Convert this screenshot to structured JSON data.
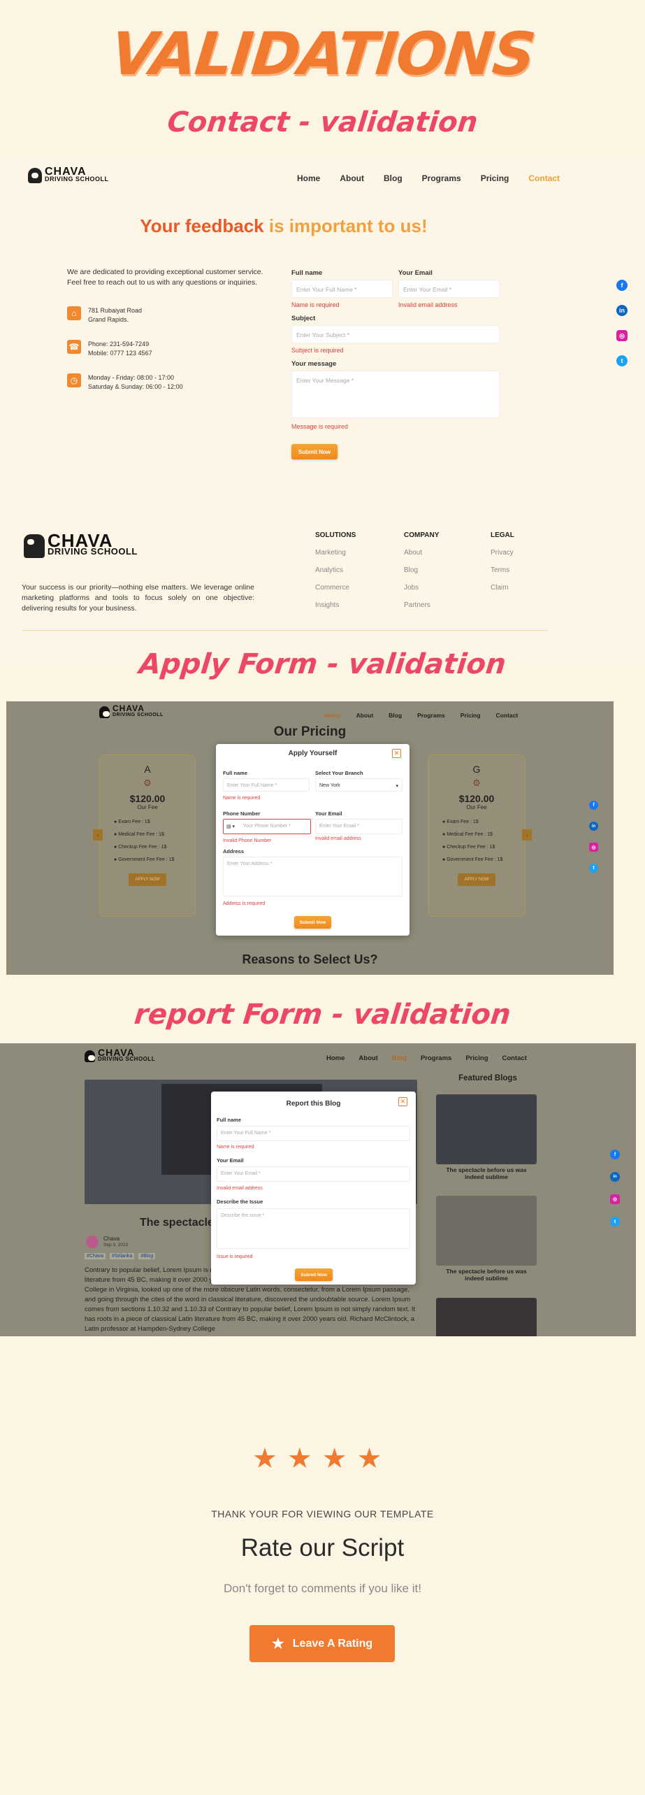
{
  "hero_title": "VALIDATIONS",
  "section_titles": {
    "contact": "Contact - validation",
    "apply": "Apply Form - validation",
    "report": "report Form - validation"
  },
  "logo": {
    "line1": "CHAVA",
    "line2": "DRIVING SCHOOLL"
  },
  "nav": [
    "Home",
    "About",
    "Blog",
    "Programs",
    "Pricing",
    "Contact"
  ],
  "contact": {
    "headline_a": "Your feedback ",
    "headline_b": "is important to us!",
    "intro": "We are dedicated to providing exceptional customer service. Feel free to reach out to us with any questions or inquiries.",
    "address": "781 Rubaiyat Road\nGrand Rapids.",
    "phone": "Phone: 231-594-7249\nMobile: 0777 123 4567",
    "hours": "Monday - Friday: 08:00 - 17:00\nSaturday & Sunday: 06:00 - 12:00",
    "full_name_label": "Full name",
    "full_name_placeholder": "Enter Your Full Name *",
    "name_error": "Name is required",
    "email_label": "Your Email",
    "email_placeholder": "Enter Your Email *",
    "email_error": "Invalid email address",
    "subject_label": "Subject",
    "subject_placeholder": "Enter Your Subject *",
    "subject_error": "Subject is required",
    "message_label": "Your message",
    "message_placeholder": "Enter Your Message *",
    "message_error": "Message is required",
    "submit": "Submit Now"
  },
  "footer": {
    "tagline": "Your success is our priority—nothing else matters. We leverage online marketing platforms and tools to focus solely on one objective: delivering results for your business.",
    "columns": [
      {
        "title": "SOLUTIONS",
        "links": [
          "Marketing",
          "Analytics",
          "Commerce",
          "Insights"
        ]
      },
      {
        "title": "COMPANY",
        "links": [
          "About",
          "Blog",
          "Jobs",
          "Partners"
        ]
      },
      {
        "title": "LEGAL",
        "links": [
          "Privacy",
          "Terms",
          "Claim"
        ]
      }
    ]
  },
  "apply": {
    "pricing_title": "Our Pricing",
    "reasons_title": "Reasons to Select Us?",
    "cards": [
      {
        "plan": "A",
        "price": "$120.00",
        "fee": "Our Fee",
        "items": [
          "Exam Fee : 1$",
          "Medical Fee Fee : 1$",
          "Checkup Fee Fee : 1$",
          "Government Fee Fee : 1$"
        ],
        "button": "APPLY NOW"
      },
      {
        "plan": "G",
        "price": "$120.00",
        "fee": "Our Fee",
        "items": [
          "Exam Fee : 1$",
          "Medical Fee Fee : 1$",
          "Checkup Fee Fee : 1$",
          "Government Fee Fee : 1$"
        ],
        "button": "APPLY NOW"
      }
    ],
    "modal": {
      "title": "Apply Yourself",
      "full_name_label": "Full name",
      "full_name_placeholder": "Enter Your Full Name *",
      "name_error": "Name is required",
      "branch_label": "Select Your Branch",
      "branch_value": "New York",
      "phone_label": "Phone Number",
      "phone_placeholder": "Your Phone Number *",
      "phone_error": "Invalid Phone Number",
      "email_label": "Your Email",
      "email_placeholder": "Enter Your Email *",
      "email_error": "Invalid email address",
      "address_label": "Address",
      "address_placeholder": "Enter Your Address *",
      "address_error": "Address is required",
      "submit": "Submit Now"
    }
  },
  "report": {
    "featured_title": "Featured Blogs",
    "post_title": "The spectacle",
    "author": "Chava",
    "date": "Sep 3, 2023",
    "tags": [
      "#Chava",
      "#Srilanka",
      "#Blog"
    ],
    "body": "Contrary to popular belief, Lorem Ipsum is not simply random text. It has roots in a piece of classical Latin literature from 45 BC, making it over 2000 years old. Richard McClintock, a Latin professor at Hampden-Sydney College in Virginia, looked up one of the more obscure Latin words, consectetur, from a Lorem Ipsum passage, and going through the cites of the word in classical literature, discovered the undoubtable source. Lorem Ipsum comes from sections 1.10.32 and 1.10.33 of Contrary to popular belief, Lorem Ipsum is not simply random text. It has roots in a piece of classical Latin literature from 45 BC, making it over 2000 years old. Richard McClintock, a Latin professor at Hampden-Sydney College",
    "featured": [
      "The spectacle before us was indeed sublime",
      "The spectacle before us was indeed sublime"
    ],
    "modal": {
      "title": "Report this Blog",
      "full_name_label": "Full name",
      "full_name_placeholder": "Enter Your Full Name *",
      "name_error": "Name is required",
      "email_label": "Your Email",
      "email_placeholder": "Enter Your Email *",
      "email_error": "Invalid email address",
      "issue_label": "Describe the Issue",
      "issue_placeholder": "Describe the issue *",
      "issue_error": "Issue is required",
      "submit": "Submit Now"
    }
  },
  "rating": {
    "stars": 4,
    "thanks": "THANK YOUR FOR VIEWING OUR TEMPLATE",
    "title": "Rate our Script",
    "subtitle": "Don't forget to comments if you like it!",
    "button": "Leave A Rating"
  },
  "colors": {
    "accent": "#f07a30",
    "error": "#e04040",
    "title_pink": "#ec4865"
  }
}
